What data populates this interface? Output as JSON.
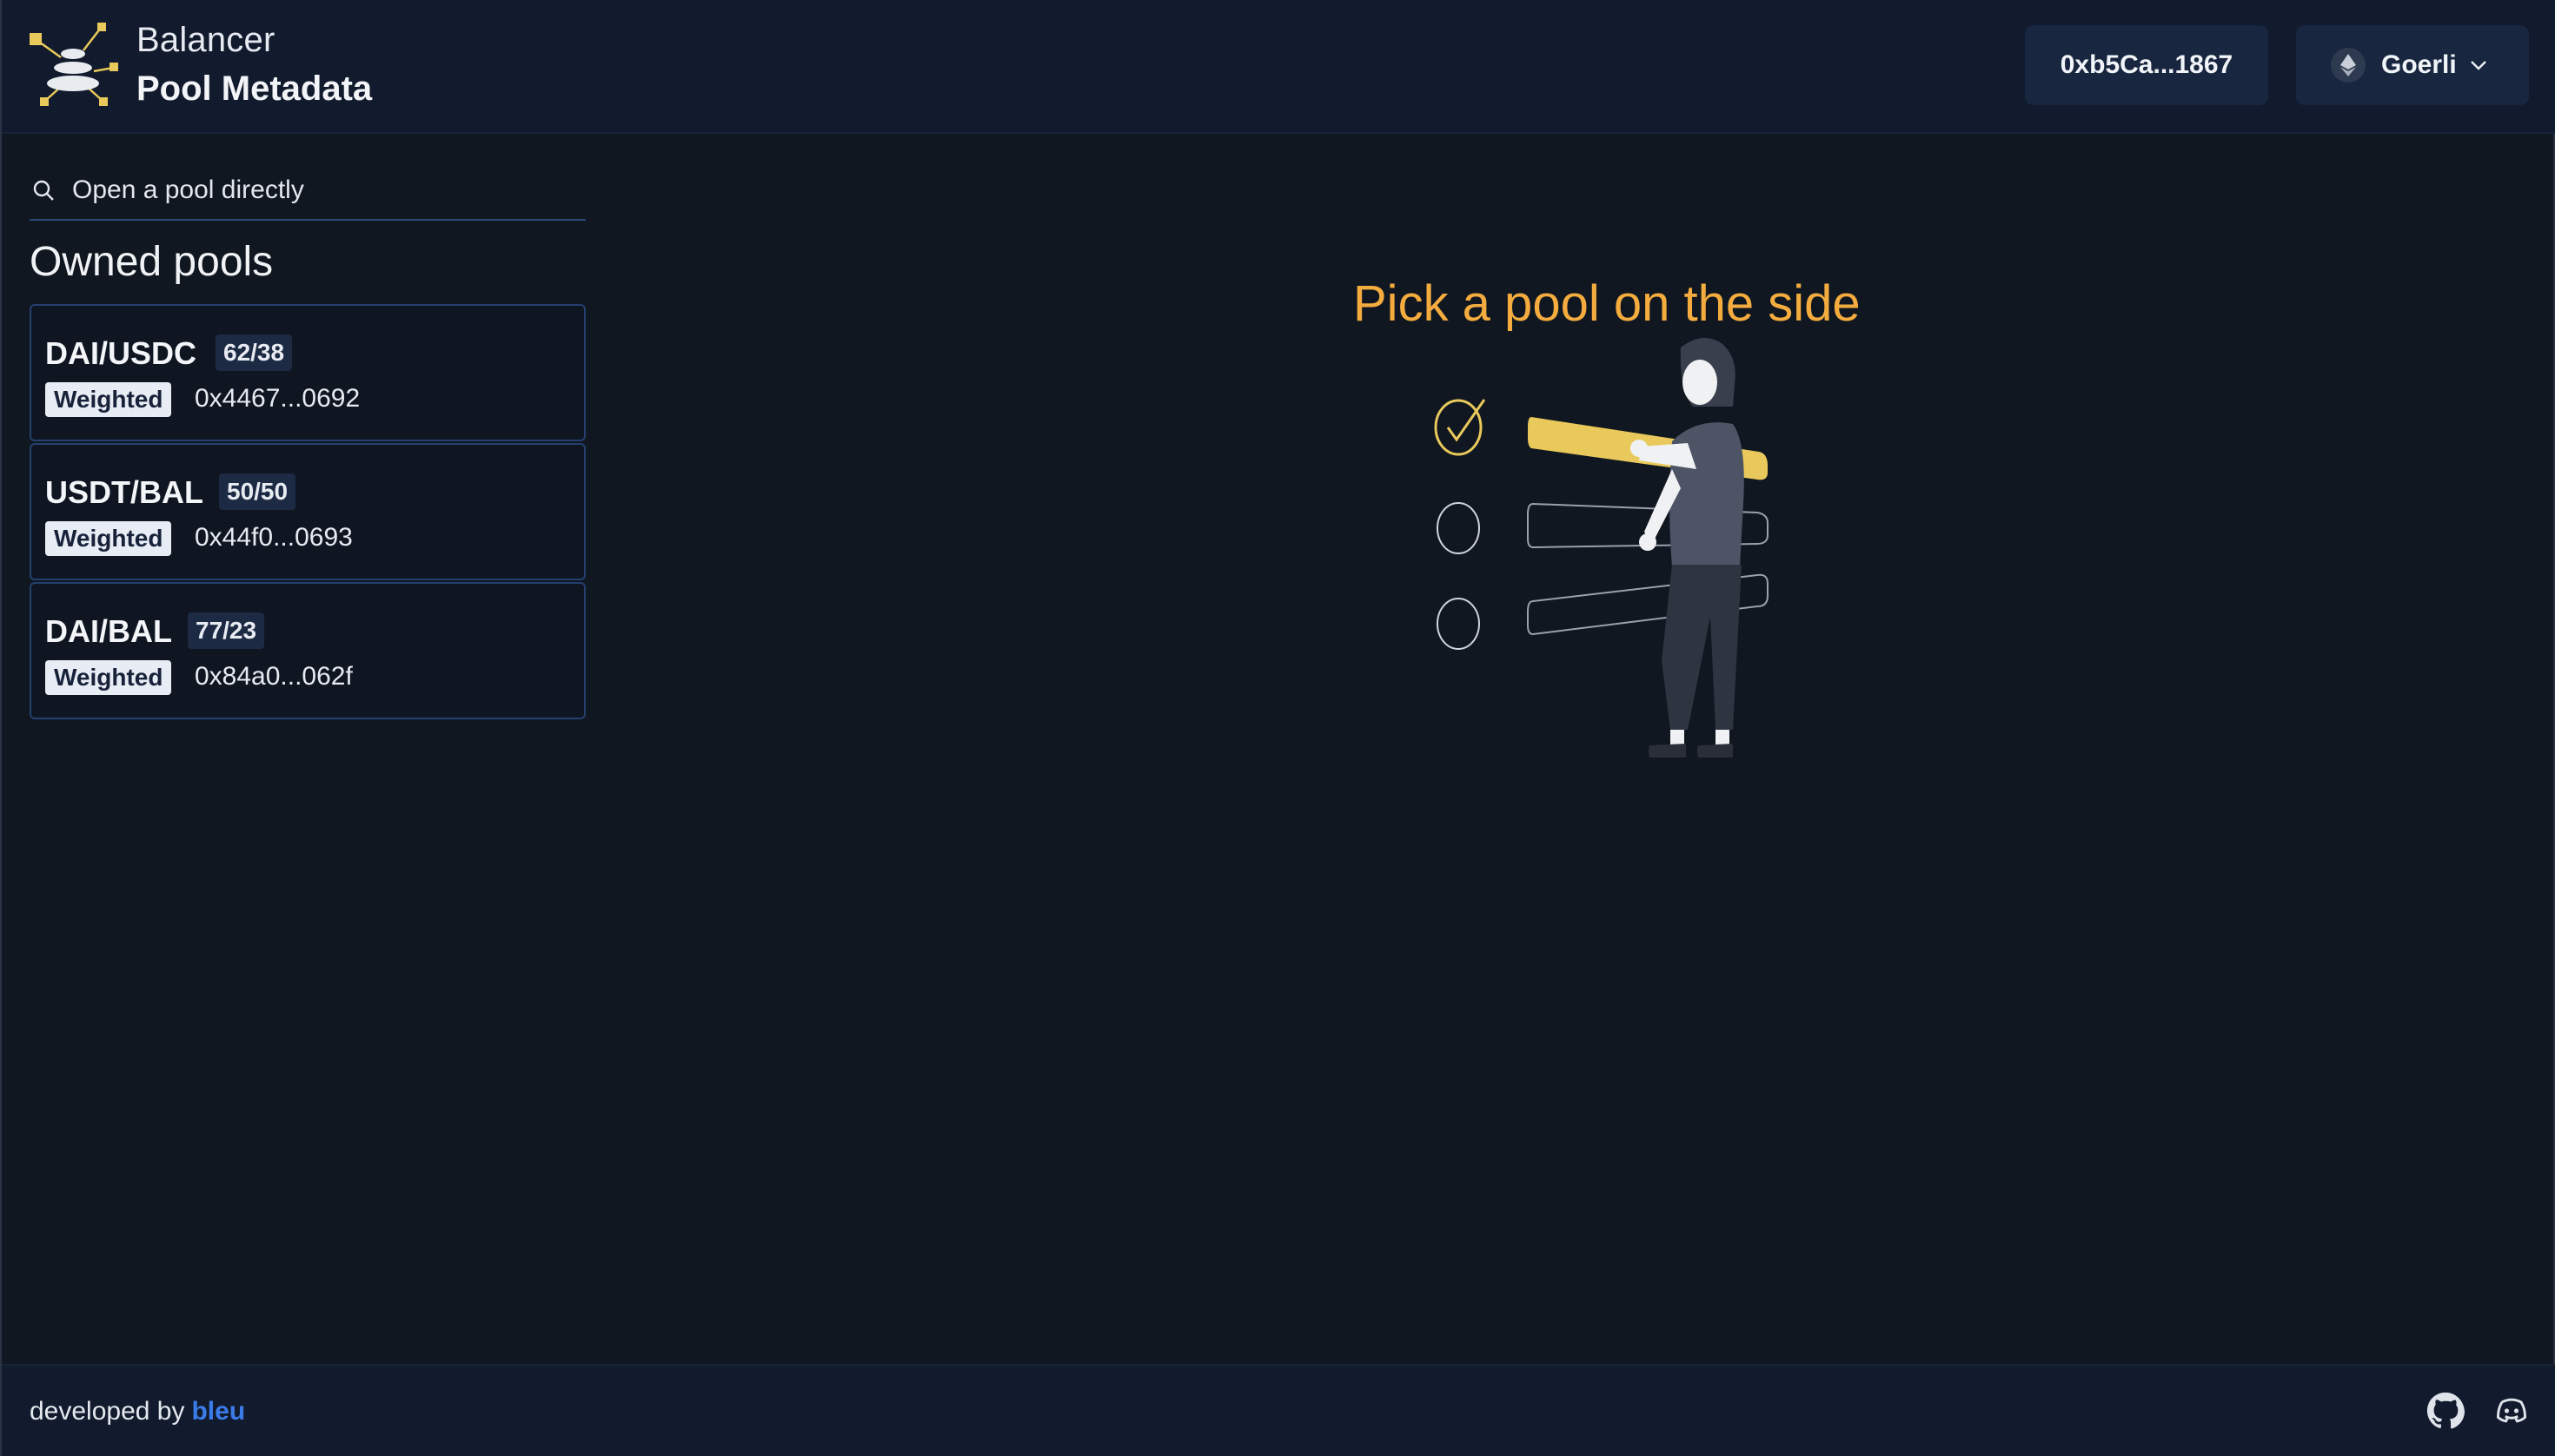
{
  "header": {
    "brand": "Balancer",
    "subtitle": "Pool Metadata",
    "wallet_address": "0xb5Ca...1867",
    "network": "Goerli"
  },
  "sidebar": {
    "search_placeholder": "Open a pool directly",
    "section_title": "Owned pools",
    "pools": [
      {
        "name": "DAI/USDC",
        "ratio": "62/38",
        "type": "Weighted",
        "address": "0x4467...0692"
      },
      {
        "name": "USDT/BAL",
        "ratio": "50/50",
        "type": "Weighted",
        "address": "0x44f0...0693"
      },
      {
        "name": "DAI/BAL",
        "ratio": "77/23",
        "type": "Weighted",
        "address": "0x84a0...062f"
      }
    ]
  },
  "main": {
    "empty_title": "Pick a pool on the side"
  },
  "footer": {
    "developed_by": "developed by",
    "developer": "bleu"
  },
  "icons": {
    "logo": "balancer-logo",
    "search": "search-icon",
    "network": "ethereum-icon",
    "dropdown": "chevron-down-icon",
    "github": "github-icon",
    "discord": "discord-icon"
  },
  "colors": {
    "background": "#101720",
    "header": "#111b2d",
    "accent": "#f5ac3f",
    "link": "#3b7be8",
    "card_border": "#25406f"
  }
}
